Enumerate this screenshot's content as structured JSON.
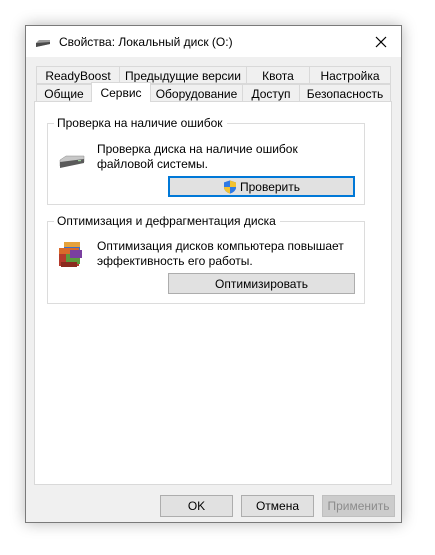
{
  "window": {
    "title": "Свойства: Локальный диск (O:)"
  },
  "tabs_row1": [
    {
      "label": "ReadyBoost"
    },
    {
      "label": "Предыдущие версии"
    },
    {
      "label": "Квота"
    },
    {
      "label": "Настройка"
    }
  ],
  "tabs_row2": [
    {
      "label": "Общие"
    },
    {
      "label": "Сервис",
      "active": true
    },
    {
      "label": "Оборудование"
    },
    {
      "label": "Доступ"
    },
    {
      "label": "Безопасность"
    }
  ],
  "error_check": {
    "title": "Проверка на наличие ошибок",
    "description": "Проверка диска на наличие ошибок файловой системы.",
    "button_label": "Проверить"
  },
  "optimize": {
    "title": "Оптимизация и дефрагментация диска",
    "description": "Оптимизация дисков компьютера повышает эффективность его работы.",
    "button_label": "Оптимизировать"
  },
  "footer": {
    "ok_label": "OK",
    "cancel_label": "Отмена",
    "apply_label": "Применить"
  },
  "colors": {
    "focus_accent": "#0078d7",
    "dialog_bg": "#f0f0f0"
  }
}
